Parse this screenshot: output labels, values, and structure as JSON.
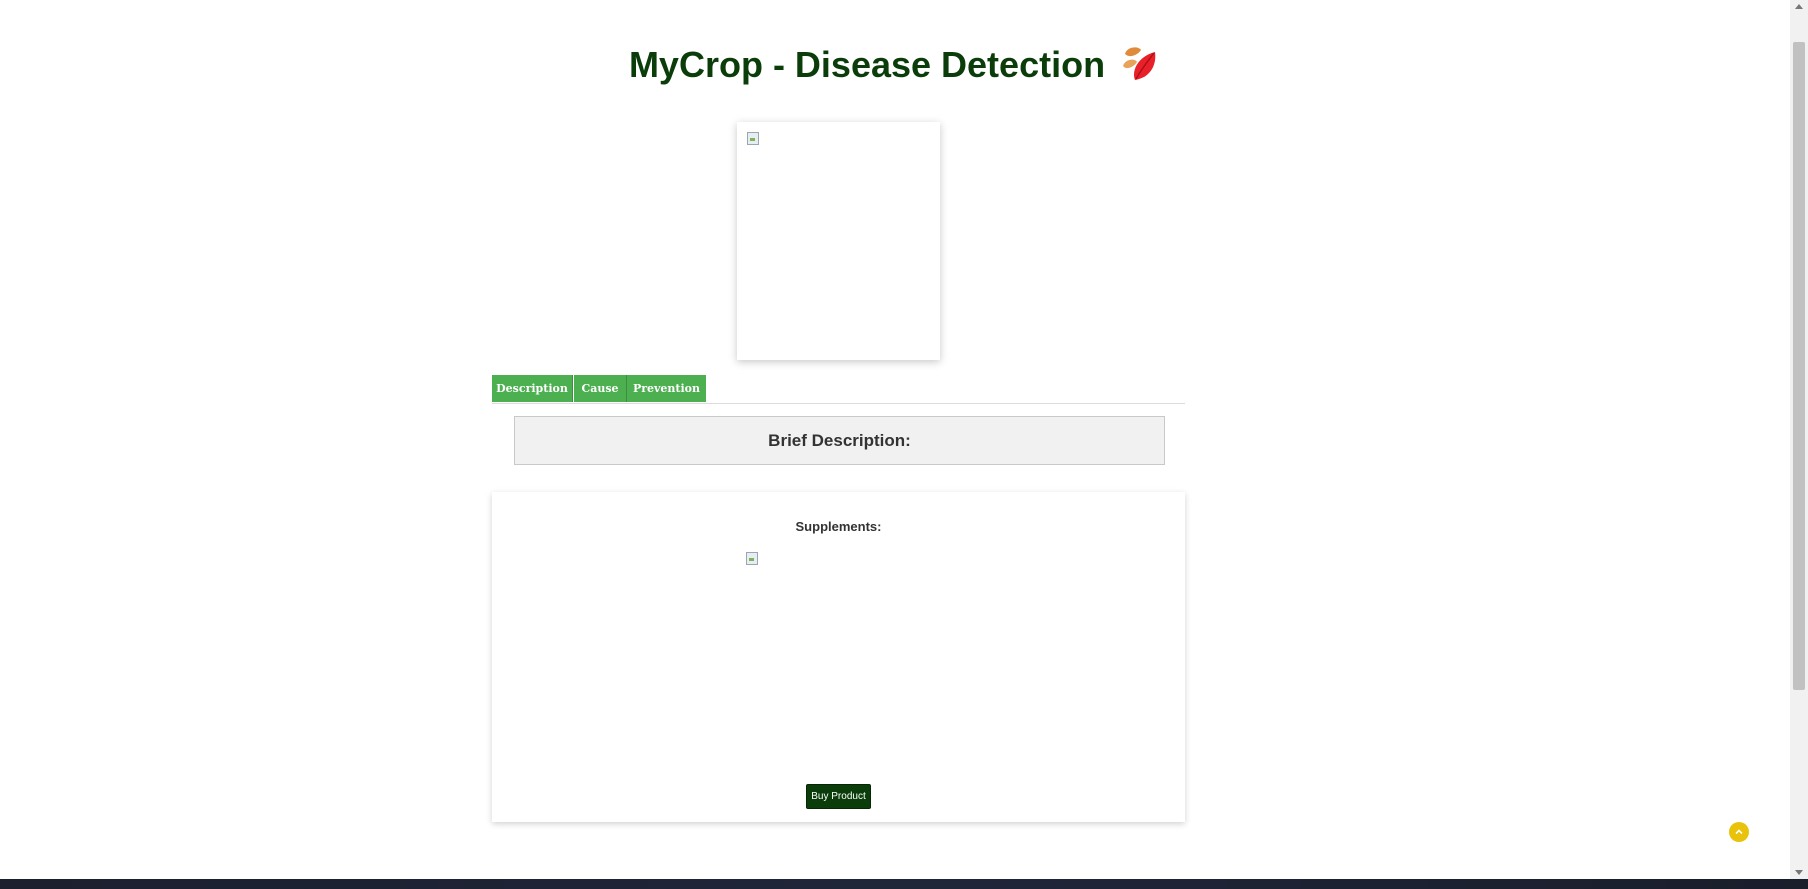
{
  "header": {
    "title": "MyCrop - Disease Detection",
    "icon": "leaves-icon"
  },
  "tabs": [
    {
      "label": "Description"
    },
    {
      "label": "Cause"
    },
    {
      "label": "Prevention"
    }
  ],
  "description": {
    "heading": "Brief Description:"
  },
  "supplements": {
    "heading": "Supplements:",
    "buy_label": "Buy Product"
  },
  "colors": {
    "title": "#0b3d0b",
    "tab": "#4caf50",
    "buy_button": "#0b3d0b",
    "scroll_top": "#e8c20b"
  }
}
